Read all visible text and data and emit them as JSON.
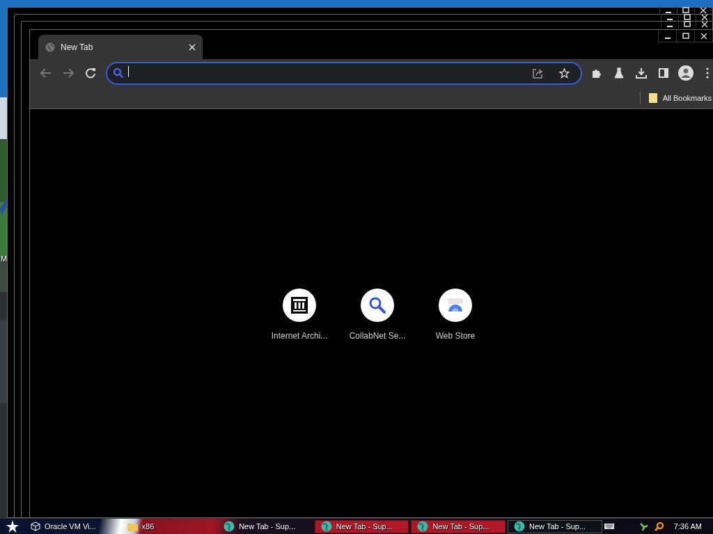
{
  "desktop": {
    "icon_label": "M"
  },
  "browser": {
    "tab": {
      "title": "New Tab",
      "selected": true
    },
    "bookmarks_bar": {
      "items": [
        {
          "label": "All Bookmarks"
        }
      ]
    },
    "shortcuts": [
      {
        "label": "Internet Archi...",
        "kind": "archive"
      },
      {
        "label": "CollabNet Se...",
        "kind": "search"
      },
      {
        "label": "Web Store",
        "kind": "store"
      }
    ]
  },
  "taskbar": {
    "items": [
      {
        "label": "Oracle VM Vi...",
        "kind": "vbox",
        "selected": false,
        "flashing": false
      },
      {
        "label": "x86",
        "kind": "folder",
        "selected": false,
        "flashing": false
      },
      {
        "label": "New Tab - Sup...",
        "kind": "browser",
        "selected": false,
        "flashing": false
      },
      {
        "label": "New Tab - Sup...",
        "kind": "browser",
        "selected": false,
        "flashing": true
      },
      {
        "label": "New Tab - Sup...",
        "kind": "browser",
        "selected": false,
        "flashing": true
      },
      {
        "label": "New Tab - Sup...",
        "kind": "browser",
        "selected": true,
        "flashing": false
      }
    ],
    "clock": "7:36 AM"
  }
}
